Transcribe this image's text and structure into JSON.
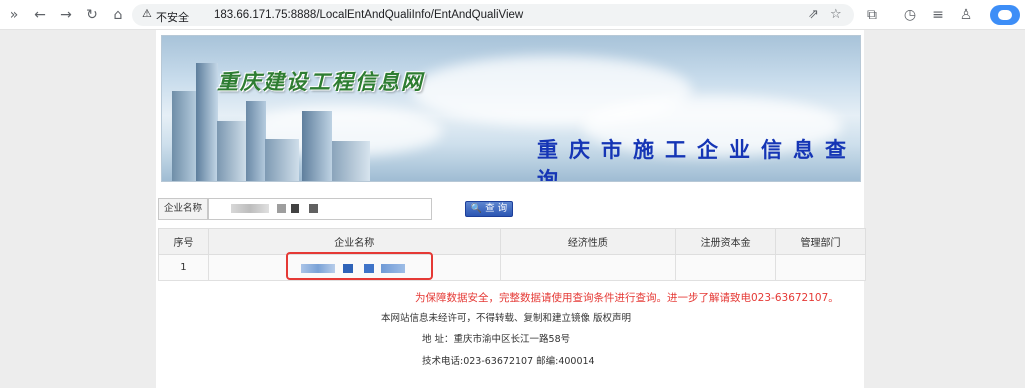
{
  "browser": {
    "security_label": "不安全",
    "url": "183.66.171.75:8888/LocalEntAndQualiInfo/EntAndQualiView",
    "icons": [
      "sidebar-toggle-icon",
      "back-icon",
      "forward-icon",
      "reload-icon",
      "home-icon",
      "warning-icon",
      "share-icon",
      "bookmark-star-icon",
      "extensions-icon",
      "history-icon",
      "menu-icon",
      "profile-icon",
      "cloud-icon"
    ]
  },
  "banner": {
    "site_title": "重庆建设工程信息网",
    "page_heading": "重庆市施工企业信息查询"
  },
  "search": {
    "label": "企业名称",
    "value": "",
    "button_label": "查 询"
  },
  "results": {
    "columns": [
      "序号",
      "企业名称",
      "经济性质",
      "注册资本金",
      "管理部门"
    ],
    "rows": [
      {
        "index": "1",
        "name": "",
        "nature": "",
        "capital": "",
        "department": ""
      }
    ]
  },
  "footer": {
    "notice": "为保障数据安全，完整数据请使用查询条件进行查询。进一步了解请致电023-63672107。",
    "copyright": "本网站信息未经许可，不得转载、复制和建立镜像 版权声明",
    "address": "地 址：重庆市渝中区长江一路58号",
    "contact": "技术电话:023-63672107    邮编:400014"
  },
  "colors": {
    "heading_blue": "#1535b5",
    "site_green": "#2e7d32",
    "notice_red": "#e53935",
    "button_blue": "#2c56b3"
  }
}
